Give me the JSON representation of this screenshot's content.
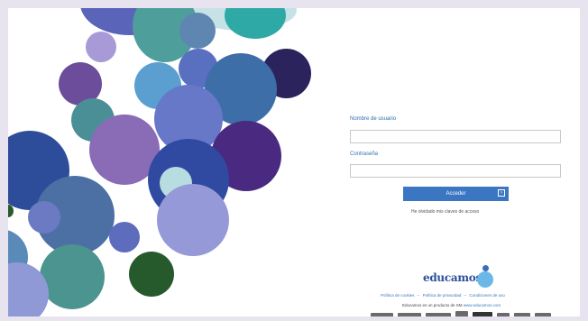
{
  "login": {
    "username_label": "Nombre de usuario",
    "password_label": "Contraseña",
    "submit_label": "Acceder",
    "forgot_link": "He olvidado mis claves de acceso"
  },
  "branding": {
    "logo_text": "educamos",
    "brand_color": "#2b4f9a"
  },
  "footer": {
    "links": [
      "Política de cookies",
      "Política de privacidad",
      "Condiciones de uso"
    ],
    "separator": "–",
    "note_prefix": "Educamos es un producto de SM",
    "note_link": "www.educamos.com",
    "partners": [
      "ediciones SM",
      "edebe",
      "partner",
      "EPE",
      "partner",
      "partner",
      "partner",
      "partner"
    ]
  },
  "colors": {
    "accent": "#3a76c2",
    "background": "#e8e4ef"
  }
}
